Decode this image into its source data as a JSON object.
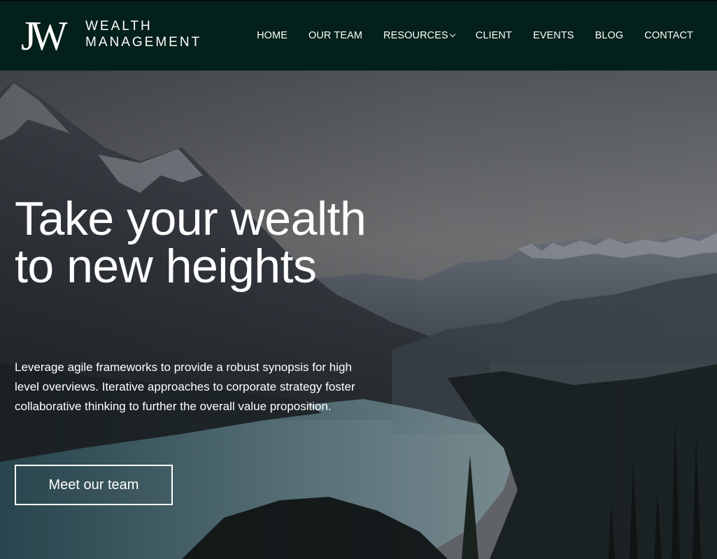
{
  "header": {
    "logo": {
      "monogram": "JW",
      "word1": "WEALTH",
      "word2": "MANAGEMENT"
    },
    "nav": [
      {
        "label": "HOME"
      },
      {
        "label": "OUR TEAM"
      },
      {
        "label": "RESOURCES",
        "has_dropdown": true
      },
      {
        "label": "CLIENT"
      },
      {
        "label": "EVENTS"
      },
      {
        "label": "BLOG"
      },
      {
        "label": "CONTACT"
      }
    ],
    "background_color": "#04201a"
  },
  "hero": {
    "title": "Take your wealth to new heights",
    "text": "Leverage agile frameworks to provide a robust synopsis for high level overviews. Iterative approaches to corporate strategy foster collaborative thinking to further the overall value proposition.",
    "cta_label": "Meet our team"
  },
  "icons": {
    "dropdown": "chevron-down-icon"
  }
}
